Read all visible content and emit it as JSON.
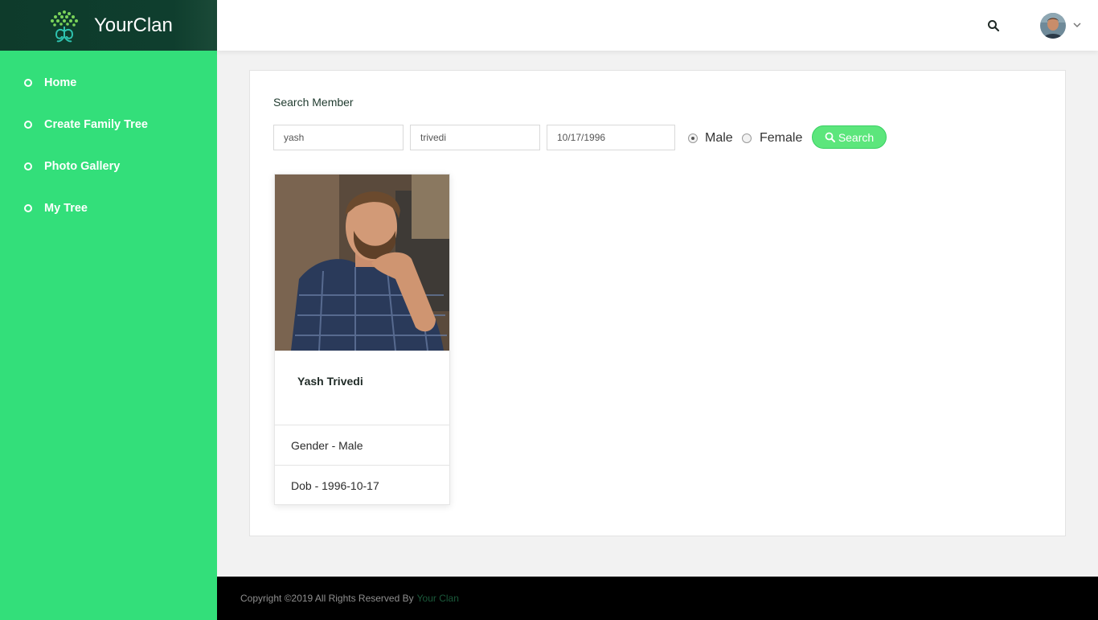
{
  "brand": {
    "name": "YourClan",
    "logo_icon": "tree-logo-icon"
  },
  "sidebar": {
    "items": [
      {
        "label": "Home"
      },
      {
        "label": "Create Family Tree"
      },
      {
        "label": "Photo Gallery"
      },
      {
        "label": "My Tree"
      }
    ]
  },
  "topbar": {
    "search_icon": "search-icon",
    "avatar_icon": "user-avatar",
    "menu_icon": "chevron-down-icon"
  },
  "search": {
    "title": "Search Member",
    "first_name": "yash",
    "last_name": "trivedi",
    "dob": "10/17/1996",
    "gender_options": [
      "Male",
      "Female"
    ],
    "gender_selected": "Male",
    "button_label": "Search"
  },
  "results": [
    {
      "name": "Yash Trivedi",
      "gender": "Gender - Male",
      "dob": "Dob - 1996-10-17"
    }
  ],
  "footer": {
    "text": "Copyright ©2019 All Rights Reserved By",
    "link": "Your Clan"
  },
  "colors": {
    "sidebar": "#33df7a",
    "brand_bg": "#0e3b2b",
    "button": "#5ce67c",
    "footer": "#000000"
  }
}
